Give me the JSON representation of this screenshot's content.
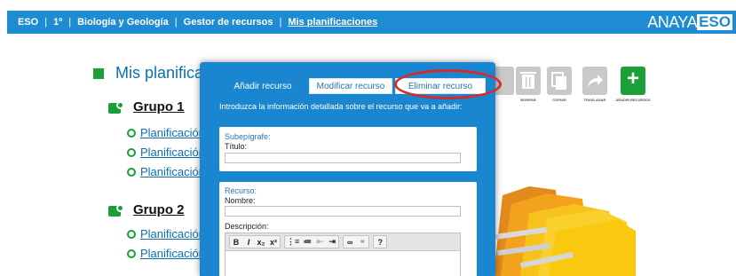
{
  "breadcrumb": [
    "ESO",
    "1º",
    "Biología y Geología",
    "Gestor de recursos",
    "Mis planificaciones"
  ],
  "brand": {
    "part1": "ANAYA",
    "part2": "ESO"
  },
  "page": {
    "title": "Mis planificac"
  },
  "groups": [
    {
      "label": "Grupo 1",
      "items": [
        "Planificación",
        "Planificación",
        "Planificación"
      ]
    },
    {
      "label": "Grupo 2",
      "items": [
        "Planificación",
        "Planificación"
      ]
    }
  ],
  "toolbar": {
    "borrar": "BORRAR",
    "copiar": "COPIAR",
    "trasladar": "TRASLADAR",
    "anadir": "AÑADIR RECURSOS"
  },
  "dialog": {
    "tabs": [
      "Añadir recurso",
      "Modificar recurso",
      "Eliminar recurso"
    ],
    "active_tab": 0,
    "intro": "Introduzca la información detallada sobre el recurso que va a añadir:",
    "section1": {
      "heading": "Subepígrafe:",
      "field_label": "Título:",
      "value": ""
    },
    "section2": {
      "heading": "Recurso:",
      "name_label": "Nombre:",
      "name_value": "",
      "desc_label": "Descripción:"
    },
    "editor_buttons": [
      "B",
      "I",
      "x₂",
      "x²",
      "⋮≡",
      "≔",
      "⇤",
      "⇥",
      "∞",
      "⚭",
      "?"
    ]
  },
  "colors": {
    "topbar": "#1e8cd2",
    "accent_green": "#1aa036",
    "link": "#0b6fb4",
    "highlight_ring": "#d42a2a"
  }
}
